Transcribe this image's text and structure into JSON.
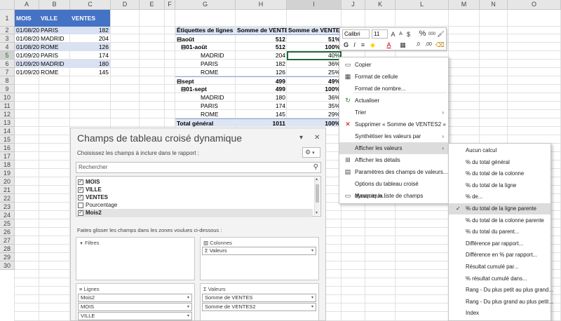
{
  "columns": [
    "A",
    "B",
    "C",
    "D",
    "E",
    "F",
    "G",
    "H",
    "I",
    "J",
    "K",
    "L",
    "M",
    "N",
    "O"
  ],
  "rows": [
    "1",
    "2",
    "3",
    "4",
    "5",
    "6",
    "7",
    "8",
    "9",
    "10",
    "11",
    "12",
    "13",
    "14",
    "15",
    "16",
    "17",
    "18",
    "19",
    "20",
    "21",
    "22",
    "23",
    "24",
    "25",
    "26",
    "27",
    "28",
    "29",
    "30"
  ],
  "table": {
    "headers": [
      "MOIS",
      "VILLE",
      "VENTES"
    ],
    "rows": [
      [
        "01/08/2021",
        "PARIS",
        "182"
      ],
      [
        "01/08/2021",
        "MADRID",
        "204"
      ],
      [
        "01/08/2021",
        "ROME",
        "126"
      ],
      [
        "01/09/2021",
        "PARIS",
        "174"
      ],
      [
        "01/09/2021",
        "MADRID",
        "180"
      ],
      [
        "01/09/2021",
        "ROME",
        "145"
      ]
    ]
  },
  "pivot": {
    "headers": [
      "Étiquettes de lignes",
      "Somme de VENTES",
      "Somme de VENTES2"
    ],
    "rows": [
      [
        "⊟août",
        "512",
        "51%"
      ],
      [
        "⊟01-août",
        "512",
        "100%"
      ],
      [
        "MADRID",
        "204",
        "40%"
      ],
      [
        "PARIS",
        "182",
        "36%"
      ],
      [
        "ROME",
        "126",
        "25%"
      ],
      [
        "⊟sept",
        "499",
        "49%"
      ],
      [
        "⊟01-sept",
        "499",
        "100%"
      ],
      [
        "MADRID",
        "180",
        "36%"
      ],
      [
        "PARIS",
        "174",
        "35%"
      ],
      [
        "ROME",
        "145",
        "29%"
      ],
      [
        "Total général",
        "1011",
        "100%"
      ]
    ]
  },
  "mini_toolbar": {
    "font": "Calibri",
    "size": "11",
    "icons": [
      "increase-font",
      "decrease-font",
      "currency",
      "percent",
      "comma-style",
      "format-brush",
      "bold",
      "italic",
      "align",
      "highlight",
      "font-color",
      "borders",
      "decrease-decimals",
      "increase-decimals",
      "clear-format"
    ],
    "glyphs": {
      "increase": "A",
      "decrease": "A",
      "currency": "$",
      "percent": "%",
      "comma": "000",
      "brush": "🖌",
      "bold": "G",
      "italic": "I",
      "align": "≡",
      "highlight": "◆",
      "fontcolor": "A",
      "borders": "▦",
      "dec": ",0",
      "inc": ",00",
      "clear": "⌫"
    }
  },
  "context_menu": {
    "items": [
      {
        "icon": "▭",
        "label": "Copier",
        "arrow": ""
      },
      {
        "icon": "▦",
        "label": "Format de cellule",
        "arrow": ""
      },
      {
        "icon": "",
        "label": "Format de nombre...",
        "arrow": ""
      },
      {
        "icon": "↻",
        "label": "Actualiser",
        "arrow": ""
      },
      {
        "icon": "",
        "label": "Trier",
        "arrow": "›"
      },
      {
        "icon": "✕",
        "label": "Supprimer « Somme de VENTES2 »",
        "arrow": ""
      },
      {
        "icon": "",
        "label": "Synthétiser les valeurs par",
        "arrow": "›"
      },
      {
        "icon": "",
        "label": "Afficher les valeurs",
        "arrow": "›"
      },
      {
        "icon": "⊞",
        "label": "Afficher les détails",
        "arrow": ""
      },
      {
        "icon": "▤",
        "label": "Paramètres des champs de valeurs...",
        "arrow": ""
      },
      {
        "icon": "",
        "label": "Options du tableau croisé dynamique...",
        "arrow": ""
      },
      {
        "icon": "▭",
        "label": "Masquer la liste de champs",
        "arrow": ""
      }
    ]
  },
  "submenu": {
    "checkmark": "✓",
    "items": [
      "Aucun calcul",
      "% du total général",
      "% du total de la colonne",
      "% du total de la ligne",
      "% de...",
      "% du total de la ligne parente",
      "% du total de la colonne parente",
      "% du total du parent...",
      "Différence par rapport...",
      "Différence en % par rapport...",
      "Résultat cumulé par...",
      "% résultat cumulé dans...",
      "Rang - Du plus petit au plus grand...",
      "Rang - Du plus grand au plus petit...",
      "Index"
    ]
  },
  "pane": {
    "title": "Champs de tableau croisé dynamique",
    "subtitle": "Choisissez les champs à inclure dans le rapport :",
    "search_placeholder": "Rechercher",
    "fields": [
      {
        "label": "MOIS",
        "checked": "✓"
      },
      {
        "label": "VILLE",
        "checked": "✓"
      },
      {
        "label": "VENTES",
        "checked": "✓"
      },
      {
        "label": "Pourcentage",
        "checked": ""
      },
      {
        "label": "Mois2",
        "checked": "✓"
      }
    ],
    "drag_hint": "Faites glisser les champs dans les zones voulues ci-dessous :",
    "zone_filters": "Filtres",
    "zone_columns": "Colonnes",
    "zone_rows": "Lignes",
    "zone_values": "Valeurs",
    "columns_items": [
      "Σ Valeurs"
    ],
    "rows_items": [
      "Mois2",
      "MOIS",
      "VILLE"
    ],
    "values_items": [
      "Somme de VENTES",
      "Somme de VENTES2"
    ],
    "icons": {
      "dropdown": "▾",
      "close": "✕",
      "gear": "⚙",
      "search": "⚲",
      "filter": "▼",
      "columns": "▥",
      "rows": "≡",
      "sigma": "Σ",
      "scroll_down": "▾",
      "scroll_up": "▴"
    }
  },
  "colors": {
    "accent": "#1d6b3b",
    "table_header": "#4472c4",
    "band": "#d9e1f2",
    "pivot_header": "#dde5f2",
    "font_red": "#d00000",
    "highlight_yellow": "#ffd200"
  }
}
